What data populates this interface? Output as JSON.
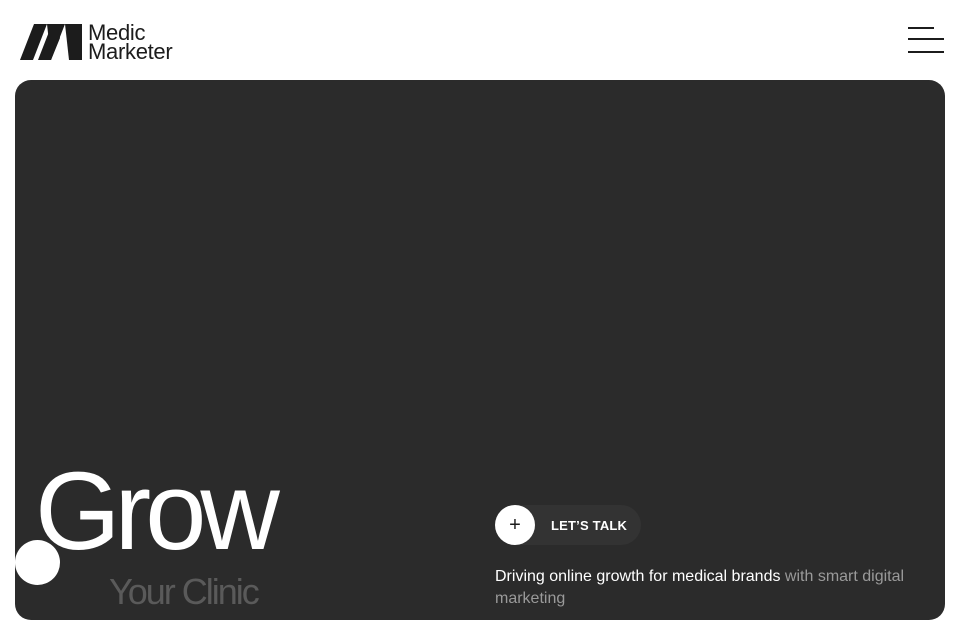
{
  "header": {
    "logo_line1": "Medic",
    "logo_line2": "Marketer",
    "logo_icon": "medic-marketer-logo-mark",
    "menu_icon": "hamburger-menu-icon"
  },
  "hero": {
    "headline": "Grow",
    "subheadline": "Your Clinic",
    "cta_label": "LET’S TALK",
    "cta_icon": "plus-icon",
    "tagline_strong": "Driving online growth for medical brands",
    "tagline_muted": " with smart digital marketing",
    "colors": {
      "hero_background": "#2b2b2b",
      "text_primary": "#ffffff",
      "text_muted": "#9a9a9a",
      "subheadline": "#5a5a5a"
    }
  }
}
